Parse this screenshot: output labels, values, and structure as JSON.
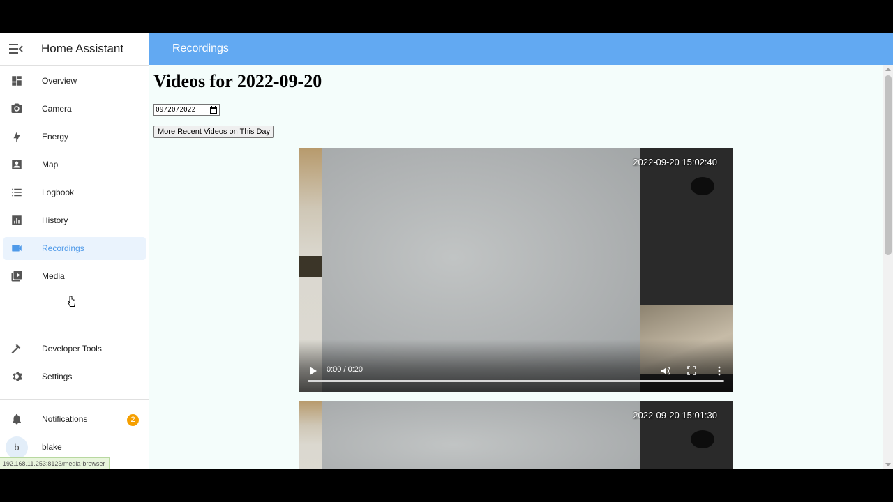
{
  "sidebar": {
    "title": "Home Assistant",
    "items": [
      {
        "label": "Overview",
        "icon": "dashboard-icon"
      },
      {
        "label": "Camera",
        "icon": "camera-icon"
      },
      {
        "label": "Energy",
        "icon": "lightning-bolt-icon"
      },
      {
        "label": "Map",
        "icon": "map-account-icon"
      },
      {
        "label": "Logbook",
        "icon": "list-icon"
      },
      {
        "label": "History",
        "icon": "chart-bar-icon"
      },
      {
        "label": "Recordings",
        "icon": "video-icon",
        "active": true
      },
      {
        "label": "Media",
        "icon": "play-box-icon"
      }
    ],
    "bottom_items": [
      {
        "label": "Developer Tools",
        "icon": "hammer-icon"
      },
      {
        "label": "Settings",
        "icon": "cog-icon"
      }
    ],
    "notifications": {
      "label": "Notifications",
      "count": "2"
    },
    "user": {
      "name": "blake",
      "initial": "b"
    }
  },
  "status_url": "192.168.11.253:8123/media-browser",
  "topbar": {
    "title": "Recordings"
  },
  "main": {
    "heading": "Videos for 2022-09-20",
    "date_value": "09/20/2022",
    "button_label": "More Recent Videos on This Day",
    "videos": [
      {
        "timestamp": "2022-09-20 15:02:40",
        "time": "0:00 / 0:20",
        "progress": 0
      },
      {
        "timestamp": "2022-09-20 15:01:30"
      }
    ]
  },
  "colors": {
    "accent": "#62a9f2",
    "active_text": "#4f9ae9",
    "badge": "#f59f00"
  }
}
